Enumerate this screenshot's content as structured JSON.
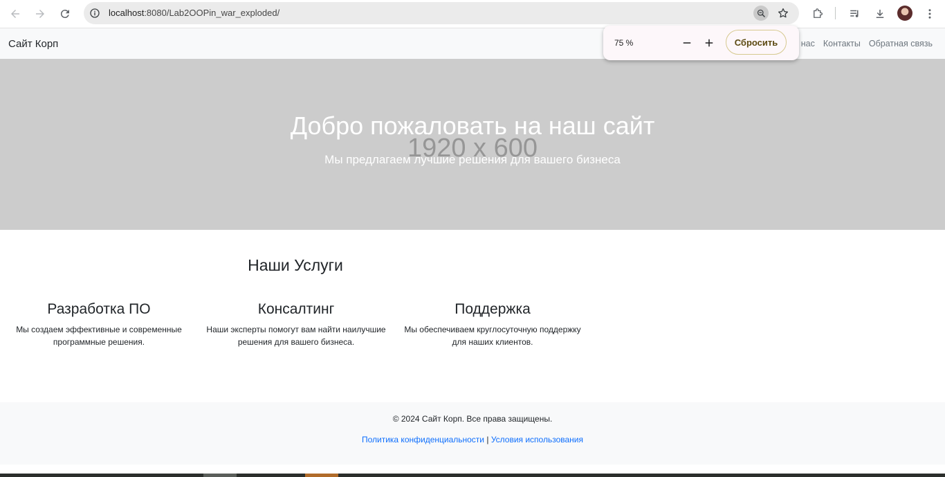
{
  "browser": {
    "url_host": "localhost",
    "url_rest": ":8080/Lab2OOPin_war_exploded/",
    "zoom_popup": {
      "percent": "75 %",
      "reset_label": "Сбросить"
    }
  },
  "navbar": {
    "brand": "Сайт Корп",
    "links": [
      "О нас",
      "Контакты",
      "Обратная связь"
    ]
  },
  "hero": {
    "placeholder": "1920 x 600",
    "title": "Добро пожаловать на наш сайт",
    "subtitle": "Мы предлагаем лучшие решения для вашего бизнеса"
  },
  "services": {
    "title": "Наши Услуги",
    "items": [
      {
        "title": "Разработка ПО",
        "text": "Мы создаем эффективные и современные программные решения."
      },
      {
        "title": "Консалтинг",
        "text": "Наши эксперты помогут вам найти наилучшие решения для вашего бизнеса."
      },
      {
        "title": "Поддержка",
        "text": "Мы обеспечиваем круглосуточную поддержку для наших клиентов."
      }
    ]
  },
  "footer": {
    "copyright": "© 2024 Сайт Корп. Все права защищены.",
    "privacy": "Политика конфиденциальности",
    "separator": "|",
    "terms": "Условия использования"
  },
  "colors": {
    "hero_bg": "#cccccc",
    "link": "#0d6efd",
    "navbar_bg": "#f8f9fa"
  }
}
